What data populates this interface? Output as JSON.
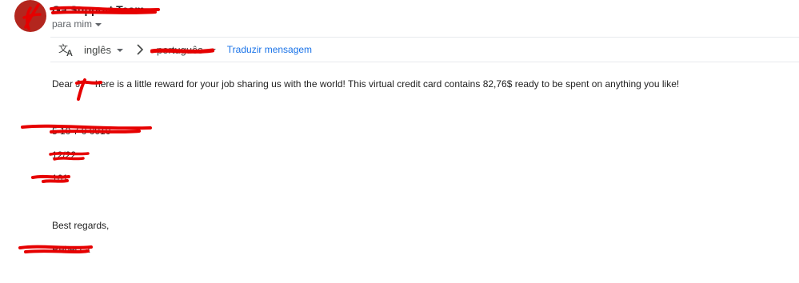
{
  "sender": {
    "name": "Ga   Support Team"
  },
  "recipient": {
    "label": "para mim"
  },
  "translate_bar": {
    "source_language": "inglês",
    "target_language": "português",
    "translate_link": "Traduzir mensagem"
  },
  "message": {
    "greeting_prefix": "Dear J",
    "body": "here is a little reward for your job sharing us with the world! This virtual credit card contains 82,76$ ready to be spent on anything you like!",
    "card_number": "5  10 7     0  0010",
    "expiry": "12/22",
    "cvv": "161",
    "closing": "Best regards,",
    "signature": "Rebecca"
  },
  "colors": {
    "redaction": "#e60000",
    "avatar": "#b3261e",
    "link": "#1a73e8"
  }
}
